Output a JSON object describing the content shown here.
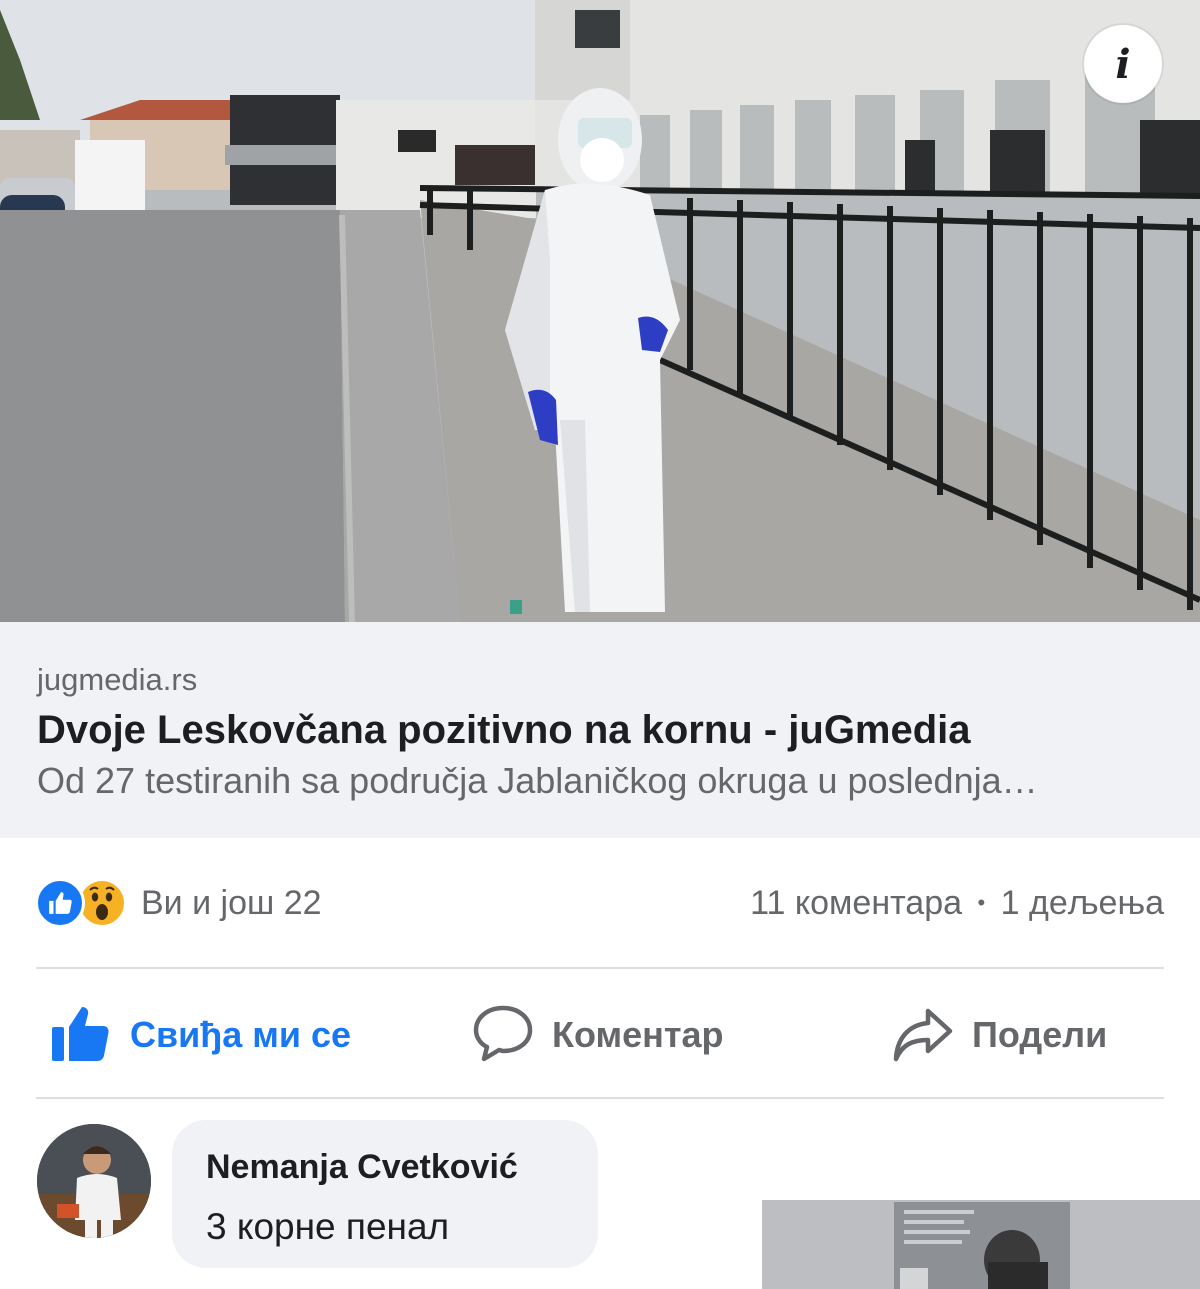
{
  "link_preview": {
    "domain": "jugmedia.rs",
    "title": "Dvoje Leskovčana pozitivno na kornu - juGmedia",
    "snippet": "Od 27 testiranih sa područja Jablaničkog okruga u poslednja…",
    "photo_icon": "info-icon"
  },
  "reactions": {
    "icons": [
      "like-reaction-icon",
      "wow-reaction-icon"
    ],
    "summary": "Ви и још 22",
    "comments": "11 коментара",
    "separator": "•",
    "shares": "1 дељења"
  },
  "actions": {
    "like": "Свиђа ми се",
    "comment": "Коментар",
    "share": "Подели"
  },
  "comment": {
    "author": "Nemanja Cvetković",
    "text": "3 корне пенал"
  },
  "colors": {
    "facebook_blue": "#1877f2",
    "secondary_text": "#65676b",
    "primary_text": "#1c1e21",
    "bubble_bg": "#f0f2f5",
    "wow_yellow": "#f7b125"
  }
}
